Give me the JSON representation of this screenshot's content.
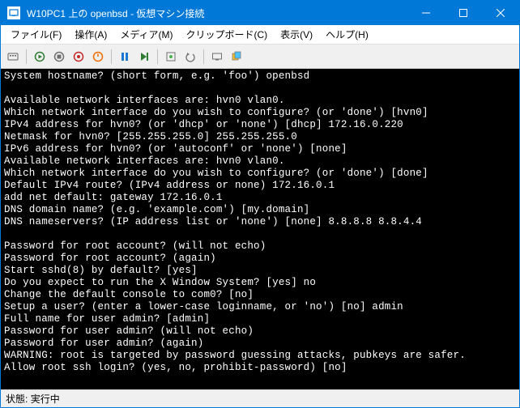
{
  "titlebar": {
    "text": "W10PC1 上の openbsd  - 仮想マシン接続"
  },
  "menu": {
    "file": "ファイル(F)",
    "action": "操作(A)",
    "media": "メディア(M)",
    "clipboard": "クリップボード(C)",
    "view": "表示(V)",
    "help": "ヘルプ(H)"
  },
  "terminal_lines": [
    "System hostname? (short form, e.g. 'foo') openbsd",
    "",
    "Available network interfaces are: hvn0 vlan0.",
    "Which network interface do you wish to configure? (or 'done') [hvn0]",
    "IPv4 address for hvn0? (or 'dhcp' or 'none') [dhcp] 172.16.0.220",
    "Netmask for hvn0? [255.255.255.0] 255.255.255.0",
    "IPv6 address for hvn0? (or 'autoconf' or 'none') [none]",
    "Available network interfaces are: hvn0 vlan0.",
    "Which network interface do you wish to configure? (or 'done') [done]",
    "Default IPv4 route? (IPv4 address or none) 172.16.0.1",
    "add net default: gateway 172.16.0.1",
    "DNS domain name? (e.g. 'example.com') [my.domain]",
    "DNS nameservers? (IP address list or 'none') [none] 8.8.8.8 8.8.4.4",
    "",
    "Password for root account? (will not echo)",
    "Password for root account? (again)",
    "Start sshd(8) by default? [yes]",
    "Do you expect to run the X Window System? [yes] no",
    "Change the default console to com0? [no]",
    "Setup a user? (enter a lower-case loginname, or 'no') [no] admin",
    "Full name for user admin? [admin]",
    "Password for user admin? (will not echo)",
    "Password for user admin? (again)",
    "WARNING: root is targeted by password guessing attacks, pubkeys are safer.",
    "Allow root ssh login? (yes, no, prohibit-password) [no]"
  ],
  "status": {
    "label": "状態:",
    "value": "実行中"
  }
}
